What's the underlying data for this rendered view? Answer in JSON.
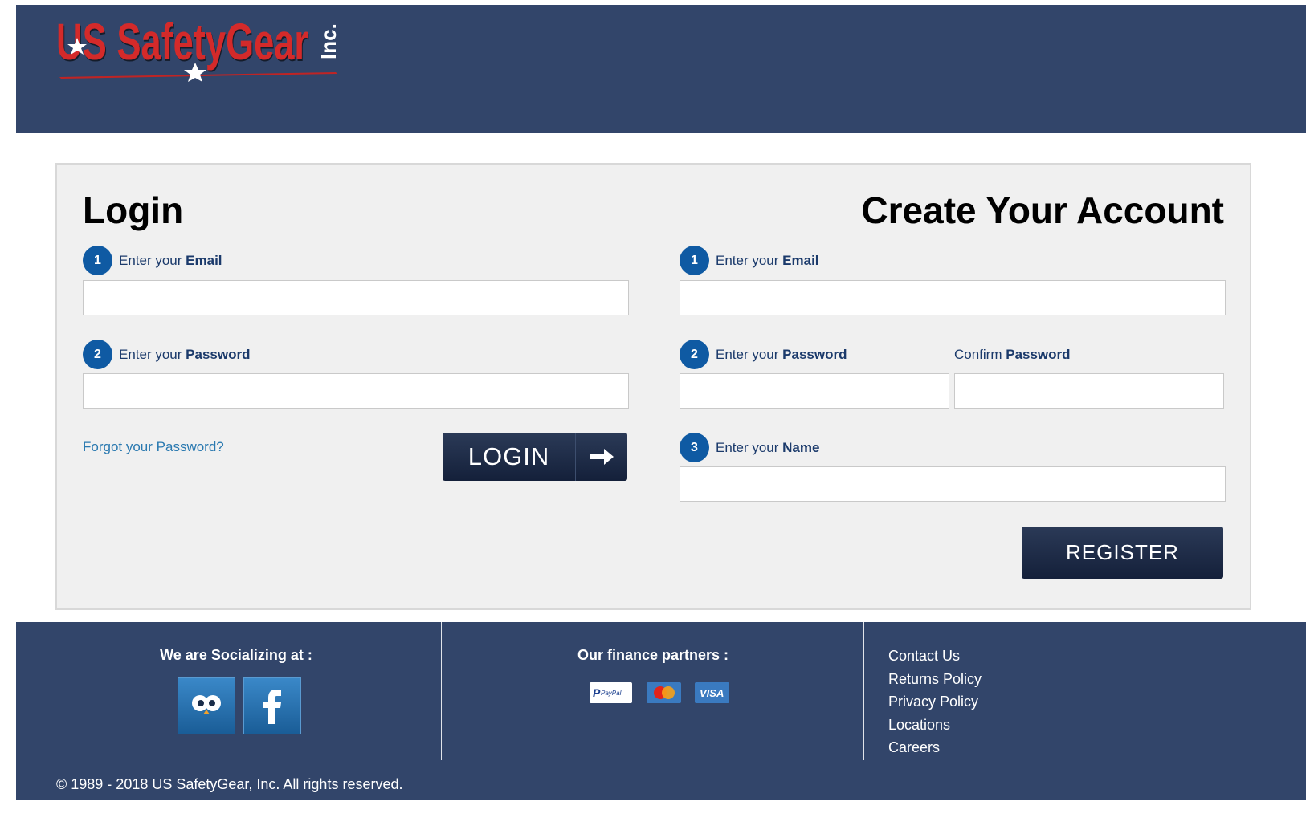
{
  "header": {
    "logo_text": "US SafetyGear",
    "logo_suffix": "Inc."
  },
  "login": {
    "title": "Login",
    "email_step": "1",
    "email_prefix": "Enter your ",
    "email_bold": "Email",
    "email_value": "",
    "password_step": "2",
    "password_prefix": "Enter your ",
    "password_bold": "Password",
    "password_value": "",
    "forgot_link": "Forgot your Password?",
    "button_label": "LOGIN"
  },
  "register": {
    "title": "Create Your Account",
    "email_step": "1",
    "email_prefix": "Enter your ",
    "email_bold": "Email",
    "email_value": "",
    "password_step": "2",
    "password_prefix": "Enter your ",
    "password_bold": "Password",
    "password_value": "",
    "confirm_prefix": "Confirm ",
    "confirm_bold": "Password",
    "confirm_value": "",
    "name_step": "3",
    "name_prefix": "Enter your ",
    "name_bold": "Name",
    "name_value": "",
    "button_label": "REGISTER"
  },
  "footer": {
    "social_heading": "We are Socializing at :",
    "finance_heading": "Our finance partners :",
    "payment_badges": [
      "PayPal",
      "MasterCard",
      "VISA"
    ],
    "links": [
      "Contact Us",
      "Returns Policy",
      "Privacy Policy",
      "Locations",
      "Careers"
    ],
    "copyright": "© 1989 - 2018 US SafetyGear, Inc. All rights reserved."
  },
  "colors": {
    "header_bg": "#32456a",
    "panel_bg": "#f0f0f0",
    "step_badge": "#0f5aa3",
    "button_dark": "#1c2a45",
    "link": "#2a79b0",
    "logo_red": "#d42a2a"
  }
}
